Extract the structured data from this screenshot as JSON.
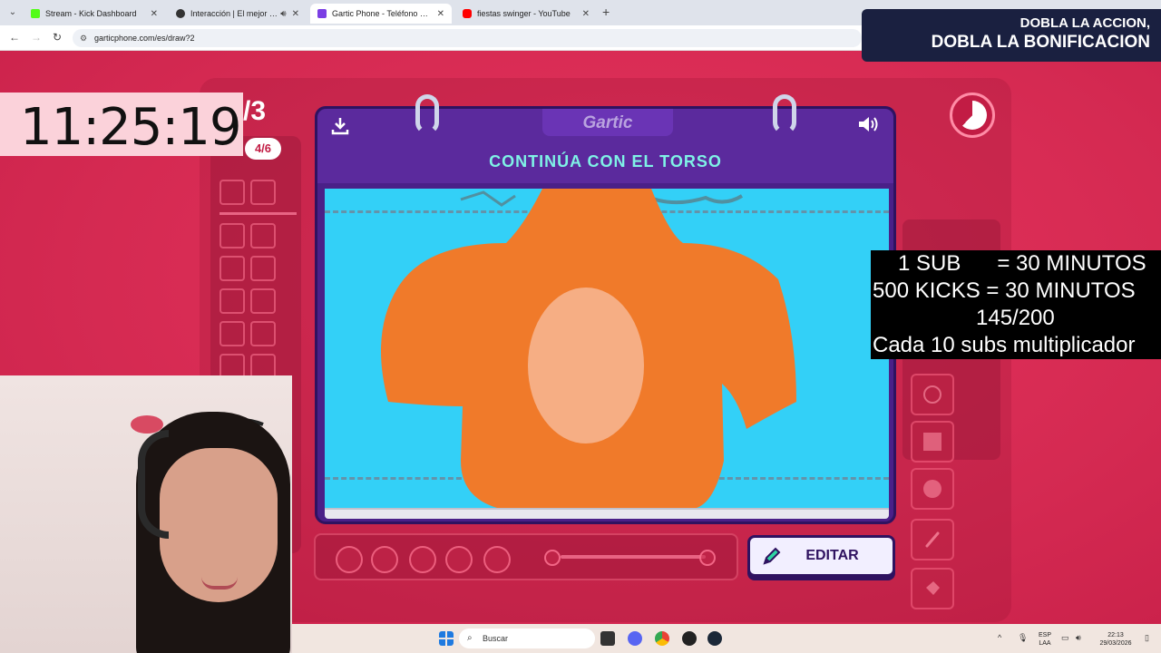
{
  "browser": {
    "tabs": [
      {
        "title": "Stream - Kick Dashboard",
        "favicon_color": "#53fc18",
        "active": false
      },
      {
        "title": "Interacción | El mejor softw...",
        "favicon_color": "#333333",
        "active": false
      },
      {
        "title": "Gartic Phone - Teléfono Descon...",
        "favicon_color": "#7b3fe4",
        "active": true
      },
      {
        "title": "fiestas swinger - YouTube",
        "favicon_color": "#ff0000",
        "active": false
      }
    ],
    "tab_close": "✕",
    "new_tab": "+",
    "url": "garticphone.com/es/draw?2"
  },
  "promo": {
    "line1": "DOBLA LA ACCION,",
    "line2": "DOBLA LA BONIFICACION"
  },
  "overlay": {
    "clock": "11:25:19",
    "round": "/3",
    "players": "4/6",
    "info_lines": [
      "1 SUB      = 30 MINUTOS",
      "500 KICKS = 30 MINUTOS",
      "145/200",
      "Cada 10 subs multiplicador"
    ]
  },
  "game": {
    "logo": "Gartic",
    "prompt": "CONTINÚA CON EL TORSO",
    "edit_label": "EDITAR",
    "timer_remaining_fraction": 0.62,
    "colors": {
      "accent": "#7ff2e6",
      "notebook": "#4a2088",
      "canvas": "#33d0f7",
      "drawing": "#f07a2a"
    }
  },
  "taskbar": {
    "search_placeholder": "Buscar",
    "lang_line1": "ESP",
    "lang_line2": "LAA",
    "time": "22:13",
    "date": "29/03/2026"
  }
}
